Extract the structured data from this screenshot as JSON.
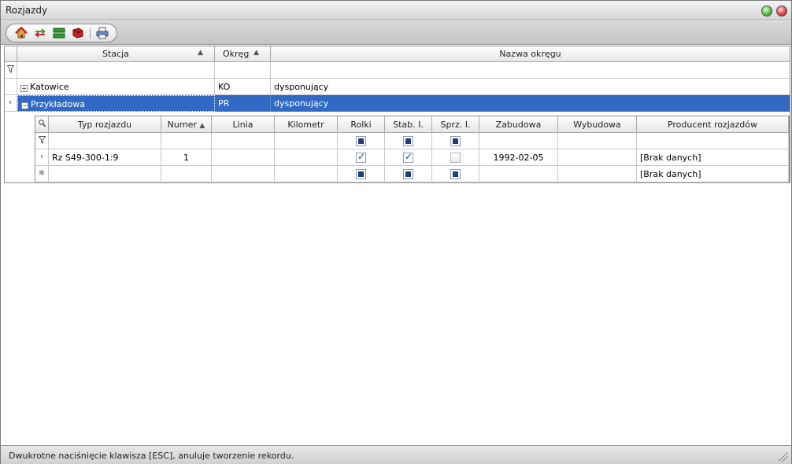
{
  "window": {
    "title": "Rozjazdy"
  },
  "toolbar": {
    "icons": [
      "home-icon",
      "transfer-icon",
      "layout-icon",
      "delete-icon",
      "print-icon"
    ]
  },
  "main_grid": {
    "columns": [
      "Stacja",
      "Okręg",
      "Nazwa okręgu"
    ],
    "rows": [
      {
        "stacja": "Katowice",
        "okreg": "KO",
        "nazwa": "dysponujący",
        "expander": "+"
      },
      {
        "stacja": "Przykładowa",
        "okreg": "PR",
        "nazwa": "dysponujący",
        "expander": "−"
      }
    ]
  },
  "detail_grid": {
    "columns": [
      "Typ rozjazdu",
      "Numer",
      "Linia",
      "Kilometr",
      "Rolki",
      "Stab. I.",
      "Sprz. I.",
      "Zabudowa",
      "Wybudowa",
      "Producent rozjazdów"
    ],
    "rows": [
      {
        "typ": "Rz S49-300-1:9",
        "numer": "1",
        "linia": "",
        "kilometr": "",
        "rolki": true,
        "stab": true,
        "sprz": false,
        "zabudowa": "1992-02-05",
        "wybudowa": "",
        "producent": "[Brak danych]"
      },
      {
        "typ": "",
        "numer": "",
        "linia": "",
        "kilometr": "",
        "rolki": null,
        "stab": null,
        "sprz": null,
        "zabudowa": "",
        "wybudowa": "",
        "producent": "[Brak danych]"
      }
    ]
  },
  "status": {
    "message": "Dwukrotne naciśnięcie klawisza [ESC], anuluje tworzenie rekordu."
  }
}
